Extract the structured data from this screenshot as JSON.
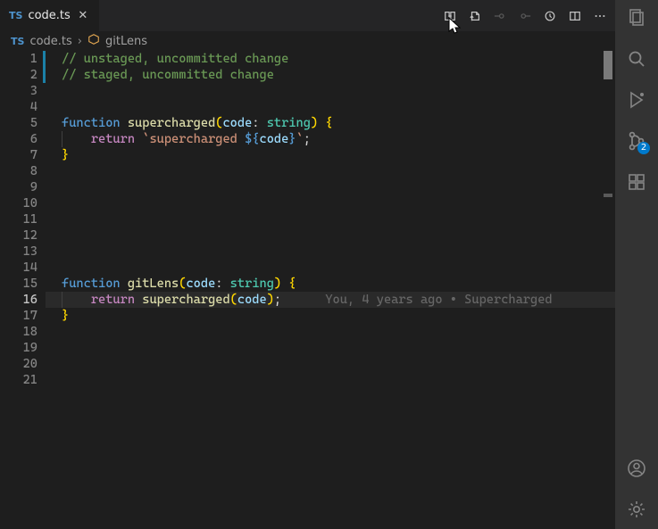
{
  "tab": {
    "lang_badge": "TS",
    "label": "code.ts"
  },
  "toolbar_icons": {
    "compare": "compare-icon",
    "changes": "file-changes-icon",
    "commit_prev": "commit-prev-icon",
    "commit_next": "commit-next-icon",
    "blame": "toggle-blame-icon",
    "split": "split-editor-icon",
    "more": "more-icon"
  },
  "breadcrumbs": {
    "file_badge": "TS",
    "file": "code.ts",
    "symbol": "gitLens"
  },
  "gutter": {
    "line_count": 21,
    "current_line": 16,
    "change_markers": [
      1,
      2
    ]
  },
  "code": {
    "1": {
      "type": "comment",
      "text": "// unstaged, uncommitted change"
    },
    "2": {
      "type": "comment",
      "text": "// staged, uncommitted change"
    },
    "3": {
      "type": "blank"
    },
    "4": {
      "type": "blank"
    },
    "5": {
      "type": "fn-decl",
      "keyword": "function",
      "name": "supercharged",
      "param": "code",
      "ptype": "string"
    },
    "6": {
      "type": "return-tpl",
      "keyword": "return",
      "tpl_prefix": "supercharged ",
      "tpl_expr": "code"
    },
    "7": {
      "type": "close-brace"
    },
    "8": {
      "type": "blank"
    },
    "9": {
      "type": "blank"
    },
    "10": {
      "type": "blank"
    },
    "11": {
      "type": "blank"
    },
    "12": {
      "type": "blank"
    },
    "13": {
      "type": "blank"
    },
    "14": {
      "type": "blank"
    },
    "15": {
      "type": "fn-decl",
      "keyword": "function",
      "name": "gitLens",
      "param": "code",
      "ptype": "string"
    },
    "16": {
      "type": "return-call",
      "keyword": "return",
      "call": "supercharged",
      "arg": "code",
      "codelens": "You, 4 years ago • Supercharged"
    },
    "17": {
      "type": "close-brace"
    },
    "18": {
      "type": "blank"
    },
    "19": {
      "type": "blank"
    },
    "20": {
      "type": "blank"
    },
    "21": {
      "type": "blank"
    }
  },
  "activity_bar": {
    "items": [
      {
        "name": "explorer-icon",
        "kind": "explorer"
      },
      {
        "name": "search-icon",
        "kind": "search"
      },
      {
        "name": "run-icon",
        "kind": "run"
      },
      {
        "name": "source-control-icon",
        "kind": "scm",
        "badge": "2"
      },
      {
        "name": "extensions-icon",
        "kind": "extensions"
      }
    ],
    "bottom": [
      {
        "name": "accounts-icon",
        "kind": "account"
      },
      {
        "name": "settings-gear-icon",
        "kind": "gear"
      }
    ]
  }
}
